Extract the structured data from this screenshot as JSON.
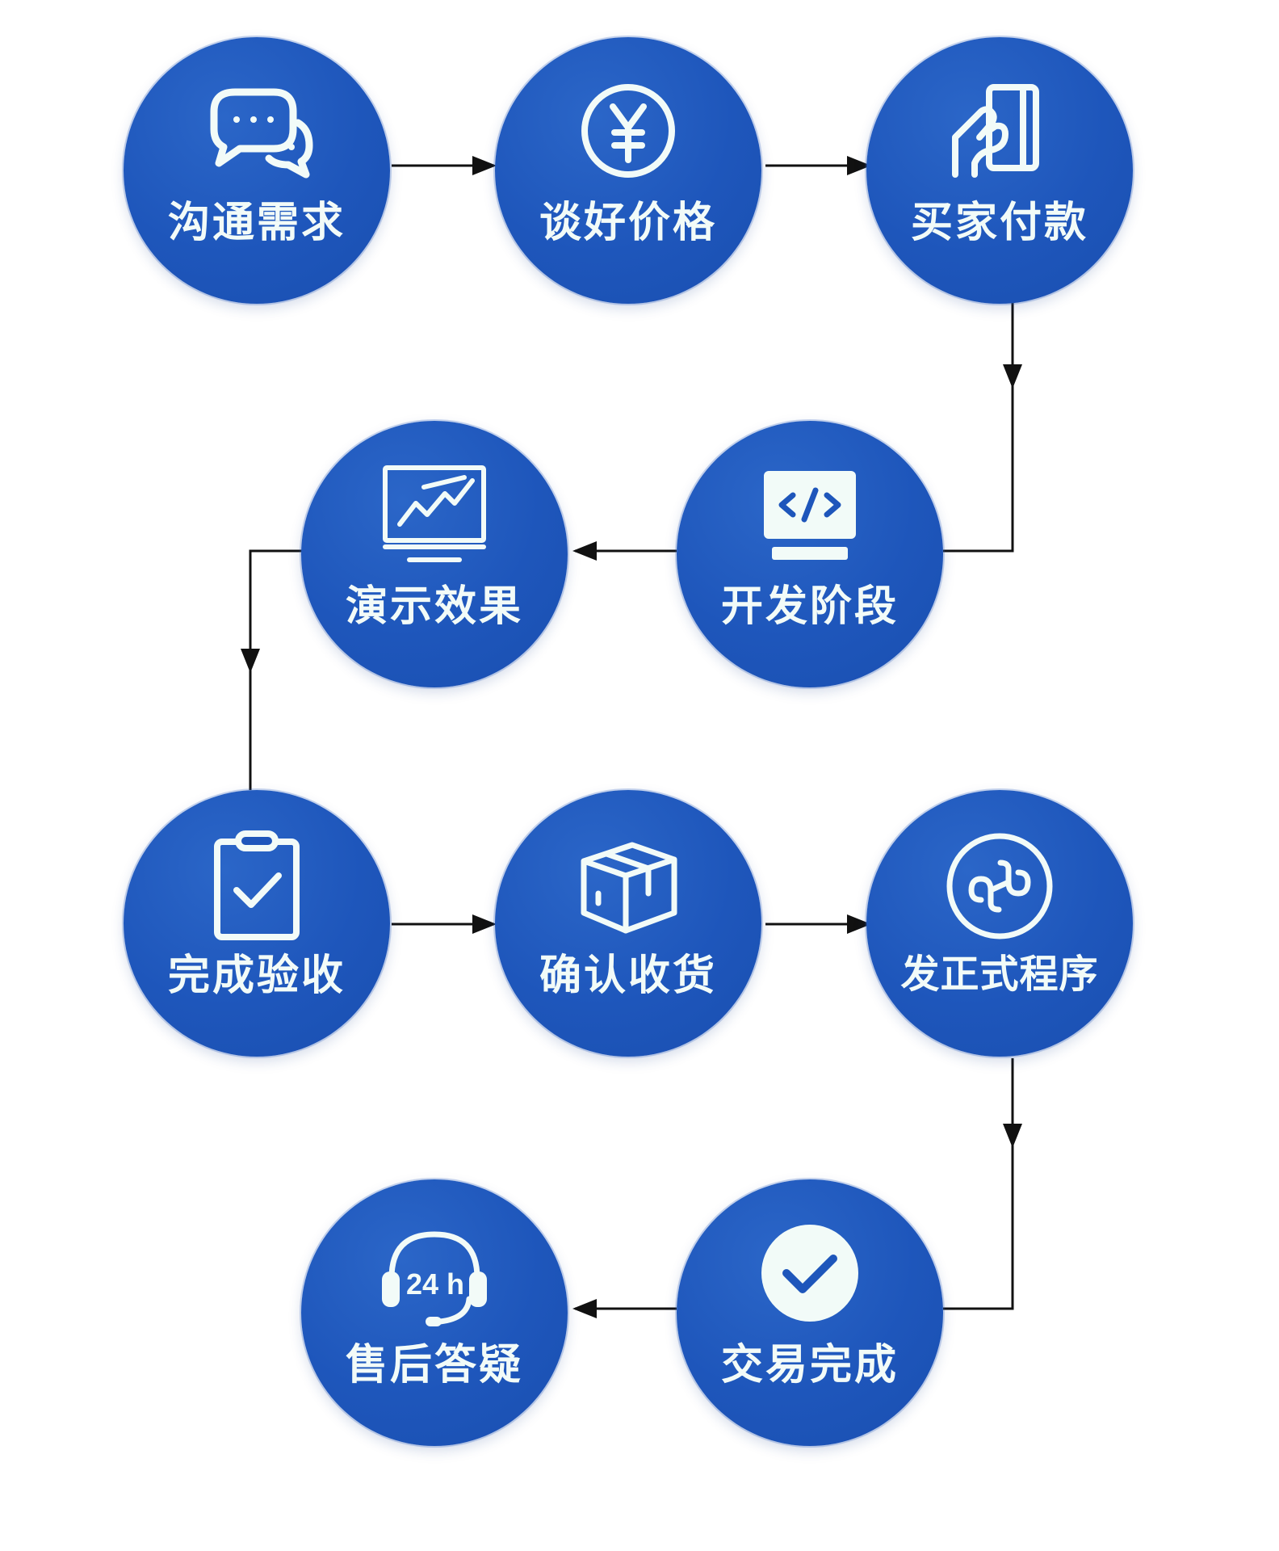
{
  "steps": [
    {
      "label": "沟通需求",
      "icon": "chat-bubbles-icon"
    },
    {
      "label": "谈好价格",
      "icon": "yuan-coin-icon"
    },
    {
      "label": "买家付款",
      "icon": "hand-card-payment-icon"
    },
    {
      "label": "开发阶段",
      "icon": "code-monitor-icon"
    },
    {
      "label": "演示效果",
      "icon": "trend-monitor-icon"
    },
    {
      "label": "完成验收",
      "icon": "clipboard-check-icon"
    },
    {
      "label": "确认收货",
      "icon": "package-box-icon"
    },
    {
      "label": "发正式程序",
      "icon": "mini-program-icon"
    },
    {
      "label": "交易完成",
      "icon": "check-circle-icon"
    },
    {
      "label": "售后答疑",
      "icon": "headset-24h-icon"
    }
  ],
  "headset_badge": "24 h",
  "colors": {
    "circle": "#1e56bb",
    "icon_stroke": "#f2fbf8",
    "connector": "#111111",
    "background": "#ffffff"
  }
}
